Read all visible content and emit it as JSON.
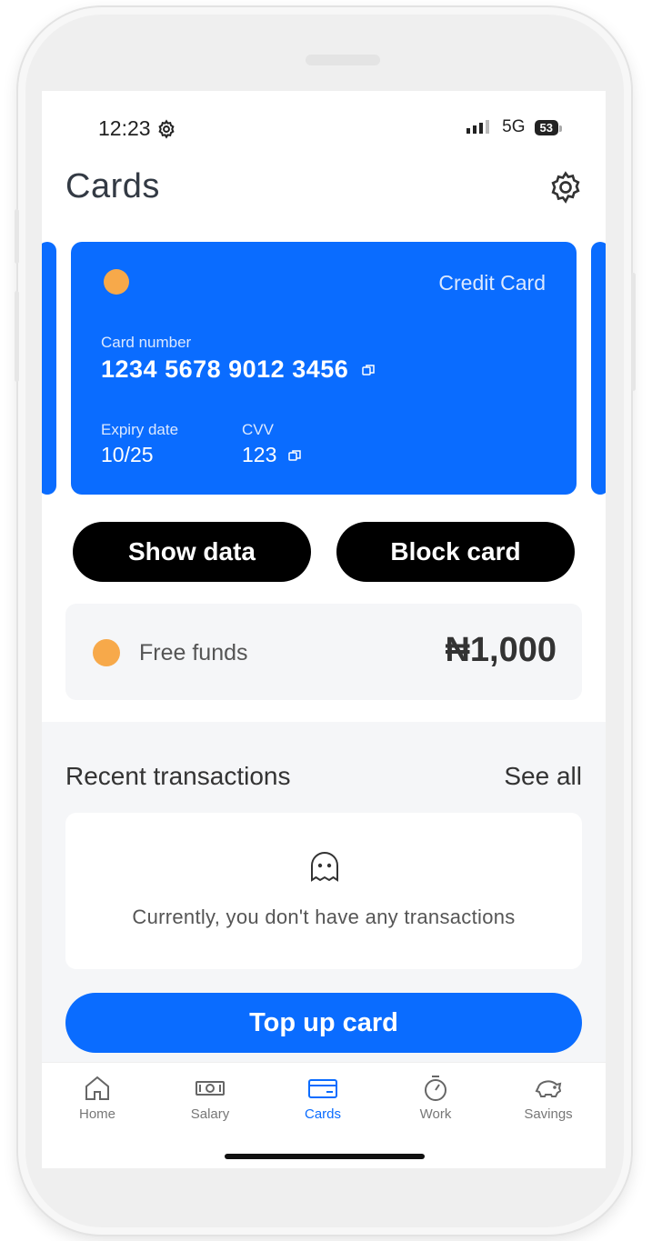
{
  "status_bar": {
    "time": "12:23",
    "network": "5G",
    "battery": "53"
  },
  "header": {
    "title": "Cards"
  },
  "card": {
    "type": "Credit Card",
    "number_label": "Card number",
    "number": "1234 5678 9012 3456",
    "expiry_label": "Expiry date",
    "expiry": "10/25",
    "cvv_label": "CVV",
    "cvv": "123"
  },
  "actions": {
    "show_data": "Show data",
    "block_card": "Block card"
  },
  "funds": {
    "label": "Free funds",
    "value": "₦1,000"
  },
  "transactions": {
    "title": "Recent transactions",
    "see_all": "See all",
    "empty_text": "Currently, you don't have any transactions"
  },
  "top_up": {
    "label": "Top up card"
  },
  "tabs": [
    {
      "label": "Home",
      "icon": "home-icon"
    },
    {
      "label": "Salary",
      "icon": "banknote-icon"
    },
    {
      "label": "Cards",
      "icon": "card-icon",
      "active": true
    },
    {
      "label": "Work",
      "icon": "stopwatch-icon"
    },
    {
      "label": "Savings",
      "icon": "piggy-bank-icon"
    }
  ],
  "colors": {
    "accent": "#0a6cff",
    "dot": "#f7a94a",
    "button_dark": "#000000"
  }
}
